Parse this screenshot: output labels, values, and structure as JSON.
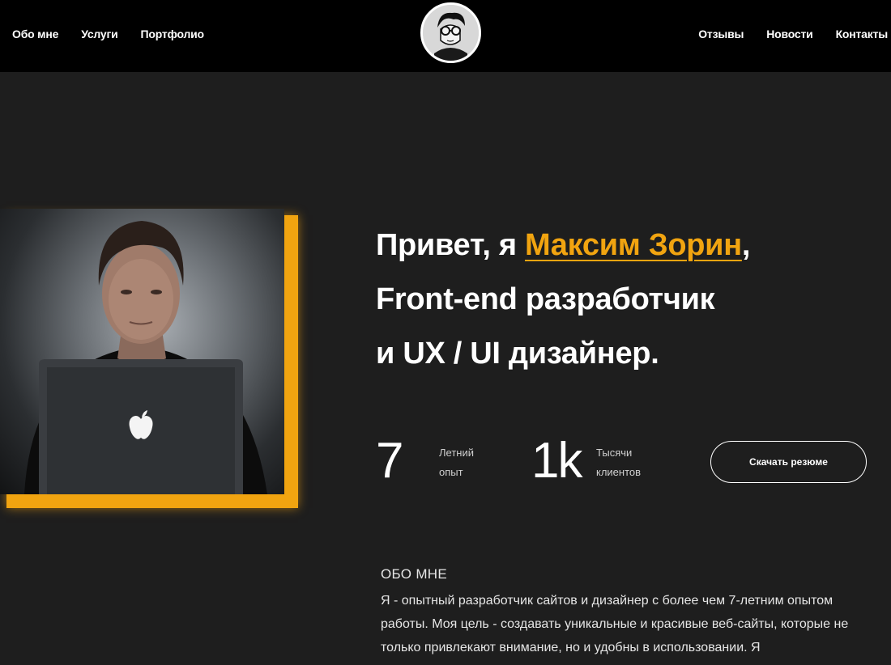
{
  "nav": {
    "left": [
      {
        "label": "Обо мне"
      },
      {
        "label": "Услуги"
      },
      {
        "label": "Портфолио"
      }
    ],
    "right": [
      {
        "label": "Отзывы"
      },
      {
        "label": "Новости"
      },
      {
        "label": "Контакты"
      }
    ],
    "logo_icon": "cartoon-avatar-with-glasses"
  },
  "hero": {
    "line1_before": "Привет, я ",
    "name": "Максим Зорин",
    "line1_after": ",",
    "line2": "Front-end разработчик",
    "line3": "и UX / UI дизайнер.",
    "accent_color": "#f1a410",
    "photo_icon": "person-with-laptop-photo"
  },
  "stats": [
    {
      "value": "7",
      "label_line1": "Летний",
      "label_line2": "опыт"
    },
    {
      "value": "1k",
      "label_line1": "Тысячи",
      "label_line2": "клиентов"
    }
  ],
  "resume_button": {
    "label": "Скачать резюме"
  },
  "about": {
    "title": "ОБО МНЕ",
    "text": "Я - опытный разработчик сайтов и дизайнер с более чем 7-летним опытом работы. Моя цель - создавать уникальные и красивые веб-сайты, которые не только привлекают внимание, но и удобны в использовании. Я"
  }
}
